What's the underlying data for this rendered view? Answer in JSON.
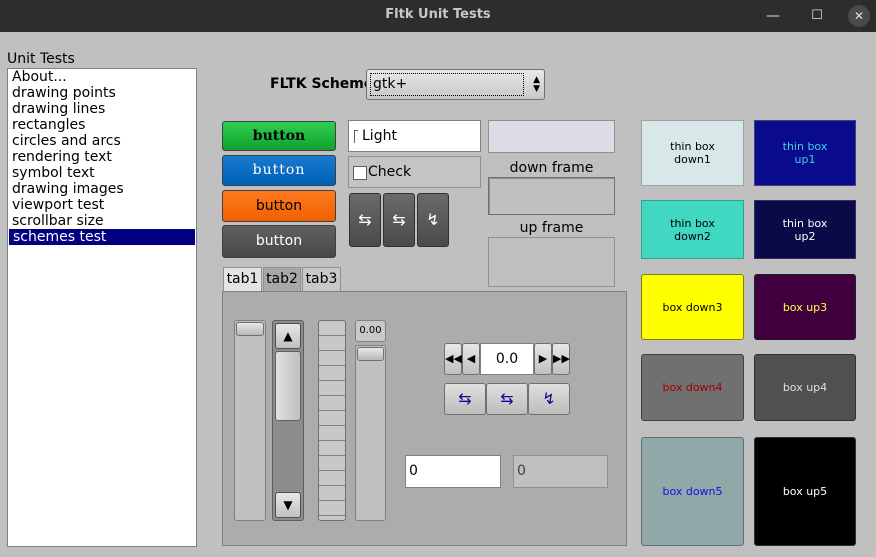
{
  "window": {
    "title": "Fltk Unit Tests",
    "minimize": "—",
    "maximize": "☐",
    "close": "✕"
  },
  "unit_tests": {
    "label": "Unit Tests",
    "items": [
      {
        "label": "About...",
        "selected": false
      },
      {
        "label": "drawing points",
        "selected": false
      },
      {
        "label": "drawing lines",
        "selected": false
      },
      {
        "label": "rectangles",
        "selected": false
      },
      {
        "label": "circles and arcs",
        "selected": false
      },
      {
        "label": "rendering text",
        "selected": false
      },
      {
        "label": "symbol text",
        "selected": false
      },
      {
        "label": "drawing images",
        "selected": false
      },
      {
        "label": "viewport test",
        "selected": false
      },
      {
        "label": "scrollbar size",
        "selected": false
      },
      {
        "label": "schemes test",
        "selected": true
      }
    ]
  },
  "scheme": {
    "label": "FLTK Scheme",
    "selected": "gtk+",
    "arrow_up": "▲",
    "arrow_down": "▼"
  },
  "buttons": [
    {
      "label": "button",
      "color": "#20c040"
    },
    {
      "label": "button",
      "color": "#0070c8"
    },
    {
      "label": "button",
      "color": "#ff7010"
    },
    {
      "label": "button",
      "color": "#505050"
    }
  ],
  "light_button": {
    "label": "Light"
  },
  "check_button": {
    "label": "Check"
  },
  "square_buttons": [
    "⇆",
    "⇆",
    "↯"
  ],
  "frames": {
    "down_label": "down frame",
    "up_label": "up frame"
  },
  "tabs": [
    {
      "label": "tab1",
      "active": true
    },
    {
      "label": "tab2",
      "active": false
    },
    {
      "label": "tab3",
      "active": false
    }
  ],
  "value_slider": {
    "value": "0.00"
  },
  "scrollbar": {
    "up": "▲",
    "down": "▼"
  },
  "counter": {
    "value": "0.0",
    "fast_back": "◀◀",
    "back": "◀",
    "fwd": "▶",
    "fast_fwd": "▶▶"
  },
  "nav_buttons": [
    "⇆",
    "⇆",
    "↯"
  ],
  "inputs": {
    "first": "0",
    "second": "0"
  },
  "boxes": [
    {
      "line1": "thin box",
      "line2": "down1",
      "bg": "#d8e8e8",
      "fg": "#000000"
    },
    {
      "line1": "thin box",
      "line2": "up1",
      "bg": "#0a0a8c",
      "fg": "#40d0e0"
    },
    {
      "line1": "thin box",
      "line2": "down2",
      "bg": "#40d8c0",
      "fg": "#000000"
    },
    {
      "line1": "thin box",
      "line2": "up2",
      "bg": "#0a0a48",
      "fg": "#ffffff"
    },
    {
      "line1": "box down3",
      "line2": "",
      "bg": "#ffff00",
      "fg": "#000000"
    },
    {
      "line1": "box up3",
      "line2": "",
      "bg": "#400040",
      "fg": "#ffff40"
    },
    {
      "line1": "box down4",
      "line2": "",
      "bg": "#707070",
      "fg": "#a00000"
    },
    {
      "line1": "box up4",
      "line2": "",
      "bg": "#505050",
      "fg": "#e0e0e0"
    },
    {
      "line1": "box down5",
      "line2": "",
      "bg": "#90a8a8",
      "fg": "#1010e0"
    },
    {
      "line1": "box up5",
      "line2": "",
      "bg": "#000000",
      "fg": "#ffffff"
    }
  ]
}
